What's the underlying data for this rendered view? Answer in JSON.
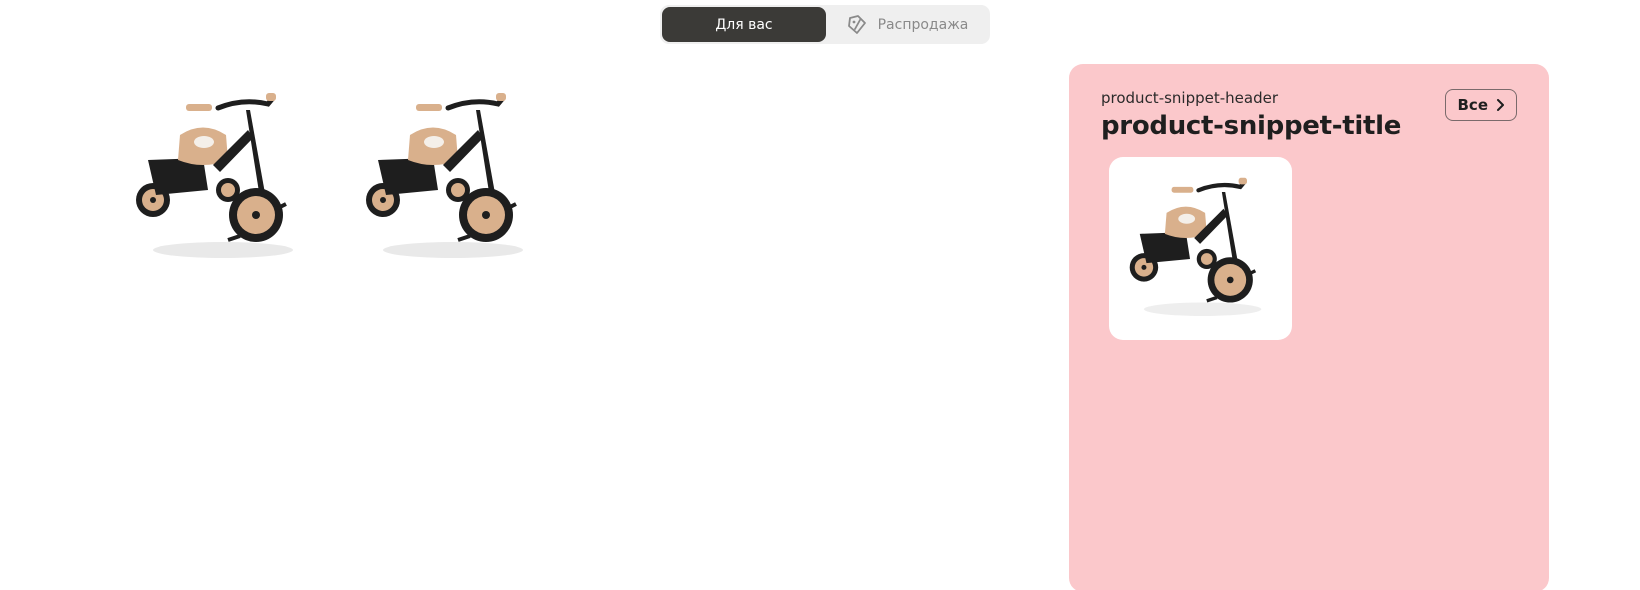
{
  "tabs": {
    "for_you": "Для вас",
    "sale": "Распродажа",
    "sale_icon": "sale-tag-icon"
  },
  "products": [
    {
      "name": "tricycle-product-image",
      "icon": "tricycle-image"
    },
    {
      "name": "tricycle-product-image",
      "icon": "tricycle-image"
    }
  ],
  "snippet": {
    "header": "product-snippet-header",
    "title": "product-snippet-title",
    "all_button": "Все",
    "background": "#fbc8cb",
    "card_icon": "tricycle-image"
  },
  "colors": {
    "active_tab": "#3b3a37",
    "tab_bar": "#efefef",
    "tan": "#d9b08c",
    "frame": "#1e1e1e"
  }
}
